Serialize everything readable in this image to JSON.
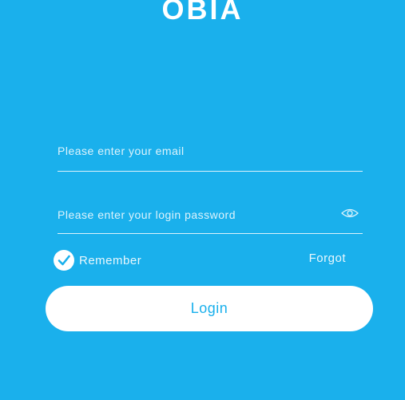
{
  "app": {
    "logo_text": "OBIA"
  },
  "login_form": {
    "email": {
      "placeholder": "Please enter your email",
      "value": ""
    },
    "password": {
      "placeholder": "Please enter your login password",
      "value": ""
    },
    "show_password_icon": "eye-icon",
    "remember": {
      "label": "Remember",
      "checked": true
    },
    "forgot_label": "Forgot",
    "login_label": "Login"
  },
  "colors": {
    "background": "#1ab0ec",
    "button": "#ffffff",
    "button_text": "#1ab0ec"
  }
}
